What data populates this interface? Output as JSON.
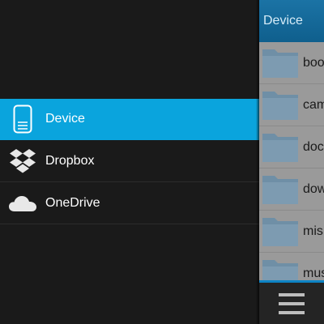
{
  "drawer": {
    "items": [
      {
        "label": "Device",
        "icon": "phone-device-icon",
        "active": true
      },
      {
        "label": "Dropbox",
        "icon": "dropbox-icon",
        "active": false
      },
      {
        "label": "OneDrive",
        "icon": "onedrive-cloud-icon",
        "active": false
      }
    ]
  },
  "panel": {
    "title": "Device",
    "folders": [
      {
        "name": "boo"
      },
      {
        "name": "cam"
      },
      {
        "name": "doc"
      },
      {
        "name": "dow"
      },
      {
        "name": "mis"
      },
      {
        "name": "mus"
      }
    ],
    "menu_icon": "hamburger-menu-icon"
  },
  "colors": {
    "accent": "#0aa4dd",
    "header": "#0f5f8d",
    "action_bar_border": "#0e84c5"
  }
}
